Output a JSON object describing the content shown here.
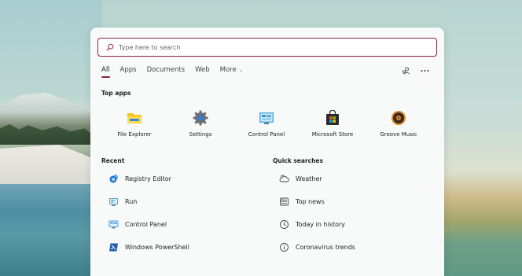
{
  "search": {
    "placeholder": "Type here to search"
  },
  "tabs": [
    {
      "label": "All",
      "active": true
    },
    {
      "label": "Apps"
    },
    {
      "label": "Documents"
    },
    {
      "label": "Web"
    },
    {
      "label": "More"
    }
  ],
  "top_apps": {
    "title": "Top apps",
    "items": [
      {
        "label": "File Explorer",
        "icon": "folder-icon"
      },
      {
        "label": "Settings",
        "icon": "gear-icon"
      },
      {
        "label": "Control Panel",
        "icon": "control-panel-icon"
      },
      {
        "label": "Microsoft Store",
        "icon": "store-bag-icon"
      },
      {
        "label": "Groove Music",
        "icon": "music-disc-icon"
      }
    ]
  },
  "recent": {
    "title": "Recent",
    "items": [
      {
        "label": "Registry Editor",
        "icon": "registry-icon"
      },
      {
        "label": "Run",
        "icon": "run-icon"
      },
      {
        "label": "Control Panel",
        "icon": "control-panel-icon"
      },
      {
        "label": "Windows PowerShell",
        "icon": "powershell-icon"
      }
    ]
  },
  "quick_searches": {
    "title": "Quick searches",
    "items": [
      {
        "label": "Weather",
        "icon": "cloud-icon"
      },
      {
        "label": "Top news",
        "icon": "news-icon"
      },
      {
        "label": "Today in history",
        "icon": "clock-icon"
      },
      {
        "label": "Coronavirus trends",
        "icon": "info-icon"
      }
    ]
  },
  "colors": {
    "accent": "#8b2235",
    "panel_bg": "#f8f9f9"
  }
}
